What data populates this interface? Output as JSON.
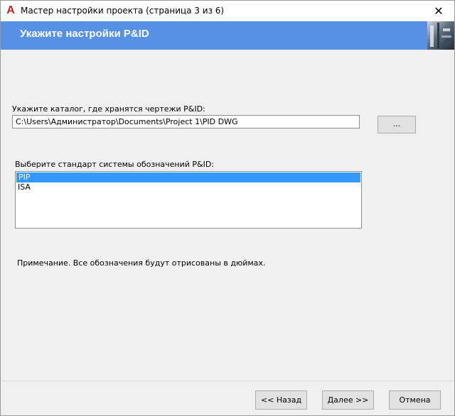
{
  "window": {
    "title": "Мастер настройки проекта (страница 3 из 6)",
    "app_icon": "autocad-logo-icon",
    "close_glyph": "✕"
  },
  "banner": {
    "title": "Укажите настройки P&ID",
    "bg_color": "#5791e6"
  },
  "catalog": {
    "label": "Укажите каталог, где хранятся чертежи P&ID:",
    "value": "C:\\Users\\Администратор\\Documents\\Project 1\\PID DWG",
    "browse_label": "..."
  },
  "standard": {
    "label": "Выберите стандарт системы обозначений P&ID:",
    "options": [
      "PIP",
      "ISA"
    ],
    "selected": "PIP"
  },
  "note": "Примечание. Все обозначения будут отрисованы в дюймах.",
  "buttons": {
    "back": "<< Назад",
    "next": "Далее >>",
    "cancel": "Отмена"
  }
}
